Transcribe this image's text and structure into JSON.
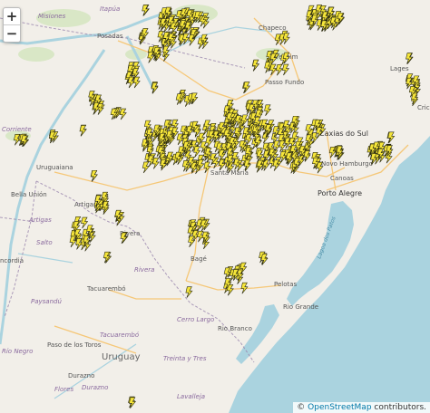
{
  "map": {
    "zoom_in": "+",
    "zoom_out": "−",
    "attribution": {
      "symbol": "©",
      "link_text": "OpenStreetMap",
      "suffix": " contributors."
    }
  },
  "labels": {
    "countries": {
      "uruguay": "Uruguay"
    },
    "cities": {
      "posadas": "Posadas",
      "chapeco": "Chapeco",
      "erechim": "Erechim",
      "passo_fundo": "Passo Fundo",
      "lages": "Lages",
      "caxias_do_sul": "Caxias do Sul",
      "novo_hamburgo": "Novo Hamburgo",
      "canoas": "Canoas",
      "porto_alegre": "Porto Alegre",
      "santa_maria": "Santa Maria",
      "uruguaiana": "Uruguaiana",
      "bella_union": "Bella Unión",
      "artigas": "Artigas",
      "rivera": "Rivera",
      "bage": "Bagé",
      "pelotas": "Pelotas",
      "rio_grande": "Rio Grande",
      "tacuarembo": "Tacuarembó",
      "rio_branco": "Rio Branco",
      "paso_de_los_toros": "Paso de los Toros",
      "durazno": "Durazno",
      "criciuma": "Crici",
      "concordia": "ncordia"
    },
    "regions": {
      "misiones": "Misiones",
      "itapua": "Itapúa",
      "corrientes": "Corriente",
      "artigas_dept": "Artigas",
      "rivera_dept": "Rivera",
      "paysandu": "Paysandú",
      "salto": "Salto",
      "cerro_largo": "Cerro Largo",
      "rio_negro": "Río Negro",
      "tacuarembo_dept": "Tacuarembó",
      "treinta_y_tres": "Treinta y Tres",
      "durazno_dept": "Durazno",
      "flores": "Flores",
      "lavalleja": "Lavalleja",
      "lagoa": "Lagoa dos Patos"
    }
  },
  "colors": {
    "land": "#f2efe9",
    "water": "#aad3df",
    "border": "#9e8bb0",
    "road": "#f6c36b",
    "lightning": "#f5e53a",
    "lightning_stroke": "#2a2a10"
  },
  "markers": {
    "icon": "lightning-icon",
    "count_visible": "many"
  }
}
